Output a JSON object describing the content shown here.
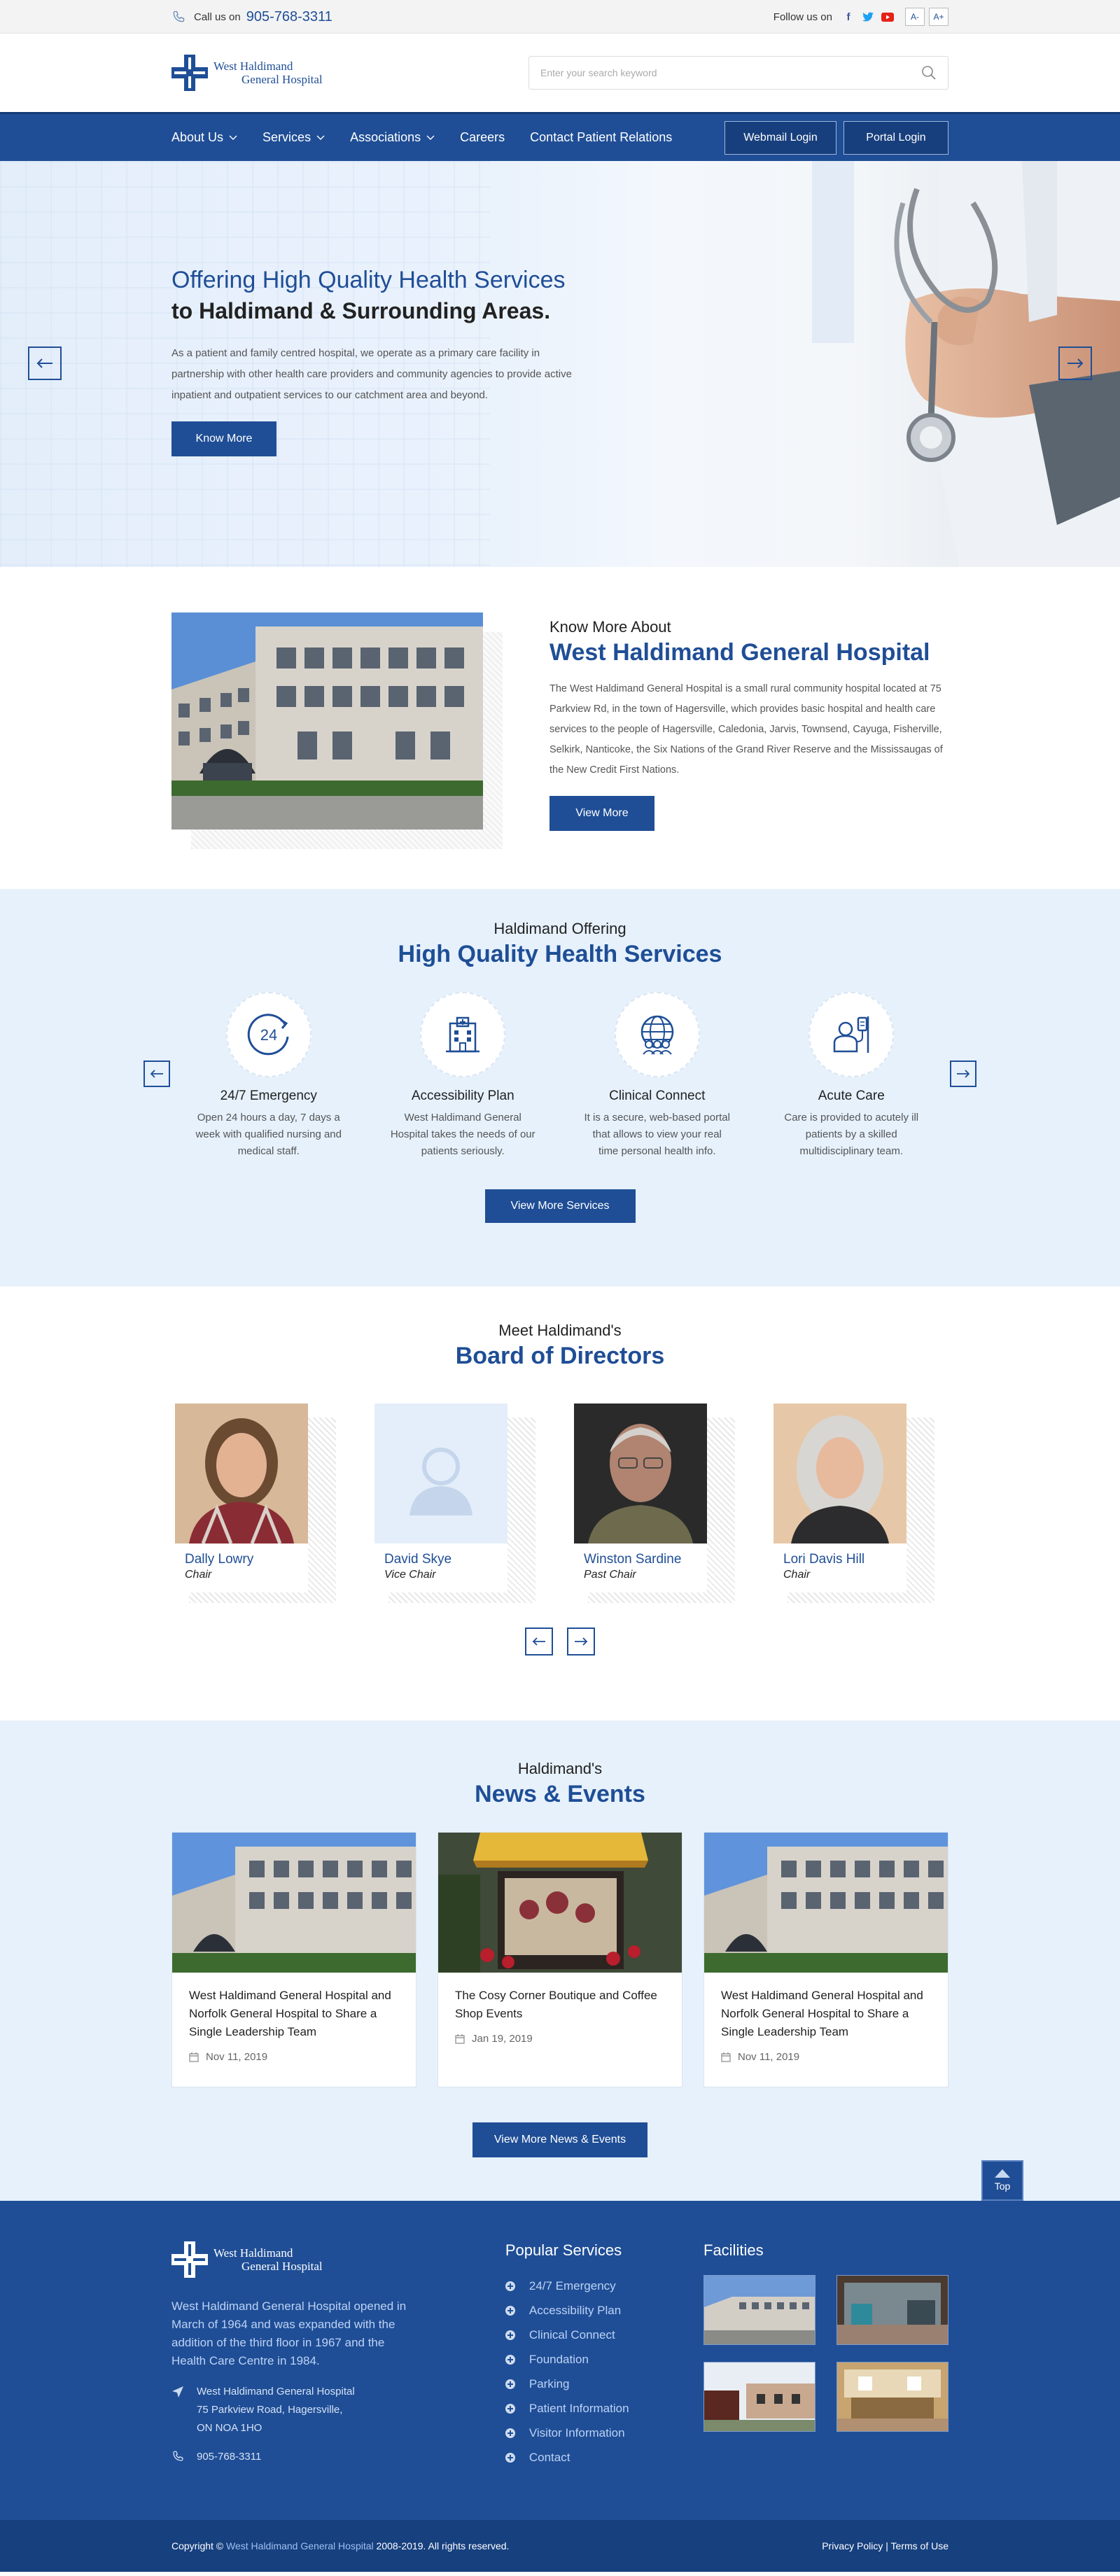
{
  "topbar": {
    "call_label": "Call us on",
    "phone": "905-768-3311",
    "follow_label": "Follow us on",
    "font_smaller": "A-",
    "font_larger": "A+"
  },
  "header": {
    "logo_line1": "West Haldimand",
    "logo_line2": "General Hospital",
    "search_placeholder": "Enter your search keyword"
  },
  "nav": {
    "items": [
      "About Us",
      "Services",
      "Associations",
      "Careers",
      "Contact Patient Relations"
    ],
    "webmail": "Webmail Login",
    "portal": "Portal Login"
  },
  "hero": {
    "title_line1": "Offering High Quality Health Services",
    "title_line2": "to Haldimand & Surrounding Areas.",
    "paragraph": "As a patient and family centred hospital, we operate as a primary care facility in partnership with other health care providers and community agencies to provide active inpatient and outpatient services to our catchment area and beyond.",
    "button": "Know More"
  },
  "about": {
    "subtitle": "Know More About",
    "title": "West Haldimand General Hospital",
    "paragraph": "The West Haldimand General Hospital is a small rural community hospital located at 75 Parkview Rd, in the town of Hagersville, which provides basic hospital and health care services to the people of Hagersville, Caledonia, Jarvis, Townsend, Cayuga, Fisherville, Selkirk, Nanticoke, the Six Nations of the Grand River Reserve and the Mississaugas of the New Credit First Nations.",
    "button": "View More"
  },
  "services": {
    "subtitle": "Haldimand Offering",
    "title": "High Quality Health Services",
    "items": [
      {
        "title": "24/7 Emergency",
        "desc": "Open 24 hours a day, 7 days a week with qualified nursing and medical staff.",
        "icon": "clock-24-icon",
        "badge": "24"
      },
      {
        "title": "Accessibility Plan",
        "desc": "West Haldimand General Hospital takes the needs of our patients seriously.",
        "icon": "hospital-building-icon"
      },
      {
        "title": "Clinical Connect",
        "desc": "It is a secure, web-based portal that allows to view your real time personal health info.",
        "icon": "globe-people-icon"
      },
      {
        "title": "Acute Care",
        "desc": "Care is provided to acutely ill patients by a skilled multidisciplinary team.",
        "icon": "patient-iv-icon"
      }
    ],
    "button": "View More Services"
  },
  "board": {
    "subtitle": "Meet Haldimand's",
    "title": "Board of Directors",
    "members": [
      {
        "name": "Dally Lowry",
        "role": "Chair"
      },
      {
        "name": "David Skye",
        "role": "Vice Chair"
      },
      {
        "name": "Winston Sardine",
        "role": "Past Chair"
      },
      {
        "name": "Lori Davis Hill",
        "role": "Chair"
      }
    ]
  },
  "news": {
    "subtitle": "Haldimand's",
    "title": "News & Events",
    "items": [
      {
        "title": "West Haldimand General Hospital and Norfolk General Hospital to Share a Single Leadership Team",
        "date": "Nov 11, 2019"
      },
      {
        "title": "The Cosy Corner Boutique and Coffee Shop Events",
        "date": "Jan 19, 2019"
      },
      {
        "title": "West Haldimand General Hospital and Norfolk General Hospital to Share a Single Leadership Team",
        "date": "Nov 11, 2019"
      }
    ],
    "button": "View More News & Events",
    "top_label": "Top"
  },
  "footer": {
    "logo_line1": "West Haldimand",
    "logo_line2": "General Hospital",
    "description": "West Haldimand General Hospital opened in March of 1964 and was expanded with the addition of the third floor in 1967 and the Health Care Centre in 1984.",
    "address_line1": "West Haldimand General Hospital",
    "address_line2": "75 Parkview Road, Hagersville,",
    "address_line3": "ON NOA 1HO",
    "phone": "905-768-3311",
    "services_heading": "Popular Services",
    "services": [
      "24/7 Emergency",
      "Accessibility Plan",
      "Clinical Connect",
      "Foundation",
      "Parking",
      "Patient Information",
      "Visitor Information",
      "Contact"
    ],
    "facilities_heading": "Facilities"
  },
  "bottom": {
    "copyright_prefix": "Copyright ©",
    "copyright_name": "West Haldimand General Hospital",
    "copyright_suffix": "2008-2019. All rights reserved.",
    "privacy": "Privacy Policy",
    "separator": "|",
    "terms": "Terms of Use"
  },
  "colors": {
    "brand": "#1f4e96",
    "light_bg": "#e6f1fc",
    "topbar": "#f3f3f3"
  }
}
